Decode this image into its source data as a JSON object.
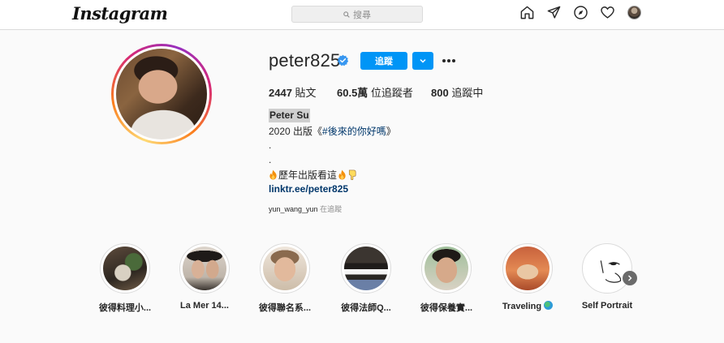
{
  "topbar": {
    "logo": "Instagram",
    "search_placeholder": "搜尋"
  },
  "profile": {
    "username": "peter825",
    "verified": true,
    "follow_label": "追蹤",
    "stats": {
      "posts_count": "2447",
      "posts_label": " 貼文",
      "followers_count": "60.5萬",
      "followers_label": " 位追蹤者",
      "following_count": "800",
      "following_label": " 追蹤中"
    },
    "full_name": "Peter Su",
    "bio": {
      "line1_prefix": "2020 出版《",
      "line1_tag": "#後來的你好嗎",
      "line1_suffix": "》",
      "line2": ".",
      "line3": ".",
      "line4_text": "歷年出版看這"
    },
    "link": "linktr.ee/peter825",
    "followed_by_user": "yun_wang_yun",
    "followed_by_suffix": " 在追蹤"
  },
  "highlights": [
    {
      "label": "彼得料理小..."
    },
    {
      "label": "La Mer 14..."
    },
    {
      "label": "彼得聯名系..."
    },
    {
      "label": "彼得法師Q..."
    },
    {
      "label": "彼得保養實..."
    },
    {
      "label": "Traveling"
    },
    {
      "label": "Self Portrait"
    }
  ],
  "colors": {
    "accent": "#0095f6",
    "link": "#00376b",
    "text": "#262626",
    "muted": "#8e8e8e"
  }
}
